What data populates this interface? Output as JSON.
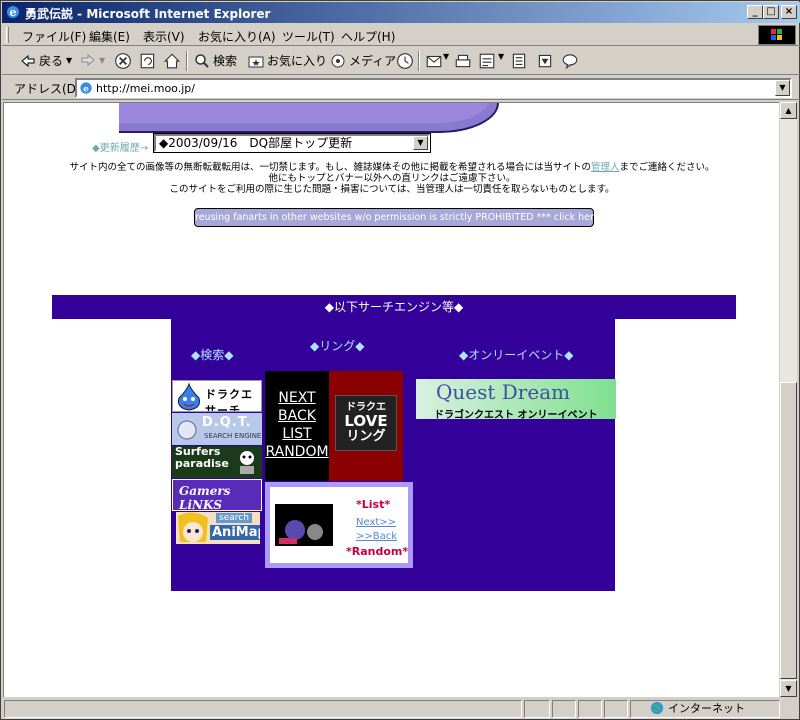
{
  "window": {
    "title": "勇武伝説 - Microsoft Internet Explorer",
    "minimize": "_",
    "maximize": "□",
    "close": "×"
  },
  "menu": {
    "items": [
      "ファイル(F)",
      "編集(E)",
      "表示(V)",
      "お気に入り(A)",
      "ツール(T)",
      "ヘルプ(H)"
    ]
  },
  "toolbar": {
    "back": "戻る",
    "search": "検索",
    "favorites": "お気に入り",
    "media": "メディア"
  },
  "address": {
    "label": "アドレス(D)",
    "url": "http://mei.moo.jp/"
  },
  "page": {
    "update_label": "◆更新履歴→",
    "update_selected": "◆2003/09/16　DQ部屋トップ更新",
    "notice_line1a": "サイト内の全ての画像等の無断転載転用は、一切禁じます。もし、雑誌媒体その他に掲載を希望される場合には当サイトの",
    "notice_link": "管理人",
    "notice_line1b": "までご連絡ください。",
    "notice_line2": "他にもトップとバナー以外への直リンクはご遠慮下さい。",
    "notice_line3": "このサイトをご利用の際に生じた問題・損害については、当管理人は一切責任を取らないものとします。",
    "english_button": "reusing fanarts in other websites w/o permission is strictly PROHIBITED *** click here/ OFP",
    "search_engine_header": "◆以下サーチエンジン等◆",
    "search_heading": "◆検索◆",
    "ring_heading": "◆リング◆",
    "only_event_heading": "◆オンリーイベント◆",
    "banners": {
      "dq_search": "ドラクエサーチ",
      "dqt": "D.Q.T.",
      "dqt_sub": "SEARCH ENGINE",
      "surfers": "Surfers paradise",
      "gamers": "Gamers LiNKS",
      "animap_top": "search",
      "animap": "AniMap",
      "quest_dream": "Quest Dream",
      "quest_dream_sub": "ドラゴンクエスト オンリーイベント",
      "dq_love_1": "ドラクエ",
      "dq_love_2": "LOVE",
      "dq_love_3": "リング"
    },
    "ring_links": [
      "NEXT",
      "BACK",
      "LIST",
      "RANDOM"
    ],
    "ring2": {
      "list": "List",
      "next": "Next>>",
      "back": ">>Back",
      "random": "Random"
    }
  },
  "status": {
    "zone": "インターネット"
  }
}
